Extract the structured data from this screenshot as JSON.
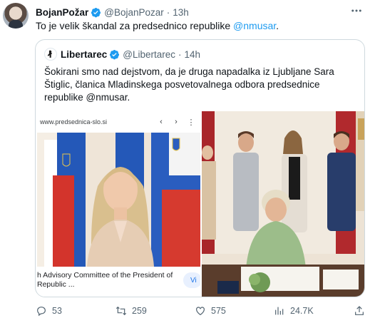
{
  "author": {
    "display_name": "BojanPožar",
    "handle": "@BojanPozar",
    "separator": "·",
    "time": "13h"
  },
  "tweet": {
    "text_prefix": "To je velik škandal za predsednico republike ",
    "mention": "@nmusar",
    "text_suffix": "."
  },
  "quote": {
    "display_name": "Libertarec",
    "handle": "@Libertarec",
    "separator": "·",
    "time": "14h",
    "text": "Šokirani smo nad dejstvom, da je druga napadalka iz Ljubljane Sara Štiglic, članica Mladinskega posvetovalnega odbora predsednice republike @nmusar.",
    "media_left": {
      "url": "www.predsednica-slo.si",
      "caption": "h Advisory Committee of the President of Republic ...",
      "button_label": "Vi"
    }
  },
  "actions": {
    "replies": "53",
    "reposts": "259",
    "likes": "575",
    "views": "24.7K"
  },
  "colors": {
    "accent": "#1d9bf0",
    "secondary_text": "#536471",
    "border": "#cfd9de"
  },
  "icons": [
    "verified-badge-icon",
    "more-icon",
    "back-arrow-icon",
    "forward-arrow-icon",
    "reply-icon",
    "repost-icon",
    "like-icon",
    "views-icon",
    "share-icon"
  ]
}
